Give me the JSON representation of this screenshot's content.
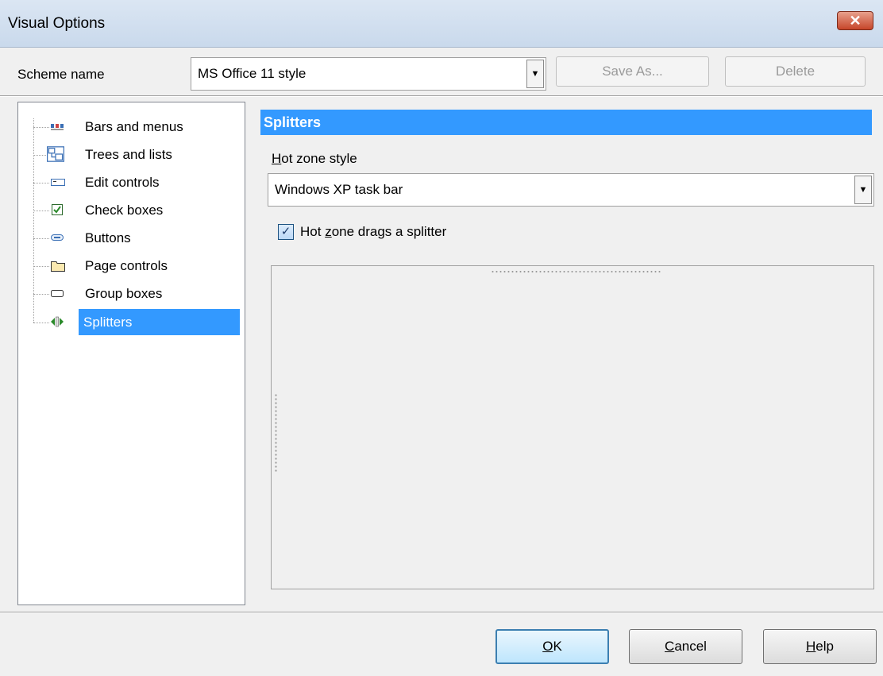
{
  "window": {
    "title": "Visual Options",
    "close_glyph": "✕"
  },
  "scheme": {
    "label": "Scheme name",
    "selected": "MS Office 11 style",
    "save_as_label": "Save As...",
    "delete_label": "Delete"
  },
  "tree": {
    "items": [
      {
        "label": "Bars and menus",
        "icon": "bars-menus-icon"
      },
      {
        "label": "Trees and lists",
        "icon": "trees-lists-icon"
      },
      {
        "label": "Edit controls",
        "icon": "edit-controls-icon"
      },
      {
        "label": "Check boxes",
        "icon": "check-boxes-icon"
      },
      {
        "label": "Buttons",
        "icon": "buttons-icon"
      },
      {
        "label": "Page controls",
        "icon": "page-controls-icon"
      },
      {
        "label": "Group boxes",
        "icon": "group-boxes-icon"
      },
      {
        "label": "Splitters",
        "icon": "splitters-icon",
        "selected": true
      }
    ]
  },
  "panel": {
    "title": "Splitters",
    "hot_zone_label_key": "H",
    "hot_zone_label_rest": "ot zone style",
    "hot_zone_value": "Windows XP task bar",
    "checkbox_pre": "Hot ",
    "checkbox_key": "z",
    "checkbox_rest": "one drags a splitter",
    "checkbox_checked": true,
    "check_glyph": "✓"
  },
  "footer": {
    "ok_key": "O",
    "ok_rest": "K",
    "cancel_key": "C",
    "cancel_rest": "ancel",
    "help_key": "H",
    "help_rest": "elp"
  },
  "colors": {
    "selection": "#3399ff",
    "header": "#3399ff"
  }
}
